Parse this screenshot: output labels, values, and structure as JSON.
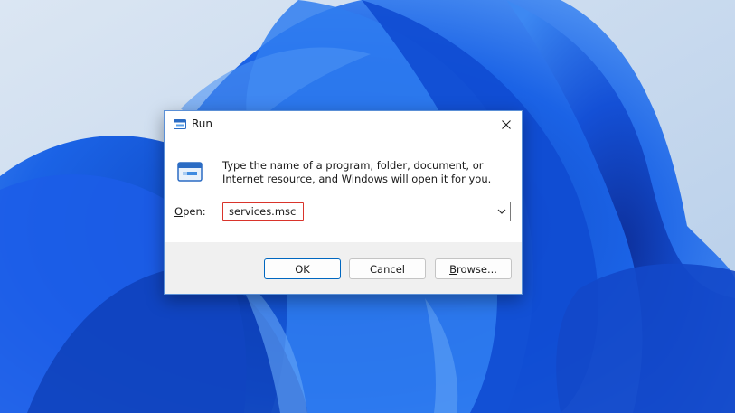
{
  "window": {
    "title": "Run",
    "title_icon": "run-icon",
    "close_icon": "close-icon"
  },
  "dialog": {
    "description": "Type the name of a program, folder, document, or Internet resource, and Windows will open it for you.",
    "open_label_prefix": "O",
    "open_label_rest": "pen:",
    "open_value": "services.msc",
    "dropdown_icon": "chevron-down-icon"
  },
  "buttons": {
    "ok": "OK",
    "cancel": "Cancel",
    "browse_prefix": "B",
    "browse_rest": "rowse..."
  },
  "colors": {
    "accent": "#0067c0",
    "highlight_box": "#d9342b",
    "wallpaper_blue": "#1f5fe0"
  }
}
